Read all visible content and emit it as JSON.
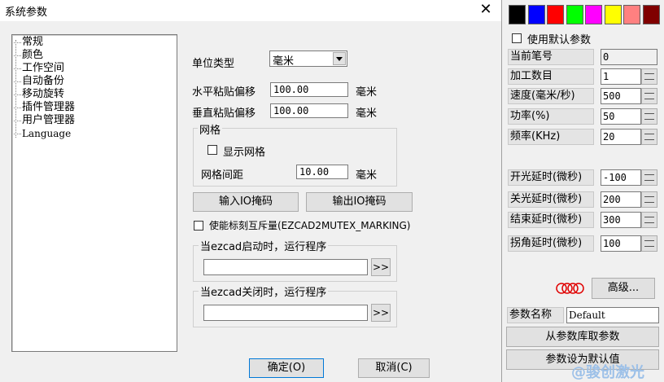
{
  "dialog": {
    "title": "系统参数",
    "close_glyph": "✕",
    "tree_items": [
      "常规",
      "颜色",
      "工作空间",
      "自动备份",
      "移动旋转",
      "插件管理器",
      "用户管理器",
      "Language"
    ],
    "unit_label": "单位类型",
    "unit_value": "毫米",
    "h_offset_label": "水平粘贴偏移",
    "h_offset_value": "100.00",
    "h_offset_unit": "毫米",
    "v_offset_label": "垂直粘贴偏移",
    "v_offset_value": "100.00",
    "v_offset_unit": "毫米",
    "grid_group_title": "网格",
    "show_grid_label": "显示网格",
    "grid_spacing_label": "网格间距",
    "grid_spacing_value": "10.00",
    "grid_spacing_unit": "毫米",
    "input_io_button": "输入IO掩码",
    "output_io_button": "输出IO掩码",
    "mutex_label": "使能标刻互斥量(EZCAD2MUTEX_MARKING)",
    "startup_group_title": "当ezcad启动时，运行程序",
    "startup_program_value": "",
    "shutdown_group_title": "当ezcad关闭时，运行程序",
    "shutdown_program_value": "",
    "browse_button": ">>",
    "ok_button": "确定(O)",
    "cancel_button": "取消(C)"
  },
  "pen_panel": {
    "colors": [
      "#000000",
      "#0000ff",
      "#ff0000",
      "#00ff00",
      "#ff00ff",
      "#ffff00",
      "#ff8080",
      "#800000"
    ],
    "use_default_label": "使用默认参数",
    "params": [
      {
        "label": "当前笔号",
        "value": "0",
        "spin": false
      },
      {
        "label": "加工数目",
        "value": "1",
        "spin": true
      },
      {
        "label": "速度(毫米/秒)",
        "value": "500",
        "spin": true
      },
      {
        "label": "功率(%)",
        "value": "50",
        "spin": true
      },
      {
        "label": "频率(KHz)",
        "value": "20",
        "spin": true
      }
    ],
    "delays": [
      {
        "label": "开光延时(微秒)",
        "value": "-100"
      },
      {
        "label": "关光延时(微秒)",
        "value": "200"
      },
      {
        "label": "结束延时(微秒)",
        "value": "300"
      },
      {
        "label": "拐角延时(微秒)",
        "value": "100"
      }
    ],
    "advanced_button": "高级...",
    "param_name_label": "参数名称",
    "param_name_value": "Default",
    "load_from_lib_button": "从参数库取参数",
    "set_default_button": "参数设为默认值"
  },
  "watermark": "@骏创激光"
}
